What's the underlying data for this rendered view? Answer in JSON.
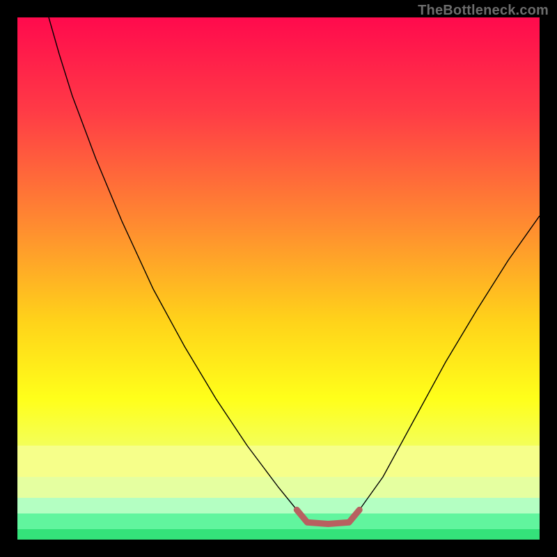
{
  "watermark": "TheBottleneck.com",
  "chart_data": {
    "type": "line",
    "title": "",
    "xlabel": "",
    "ylabel": "",
    "xlim": [
      0,
      100
    ],
    "ylim": [
      0,
      100
    ],
    "grid": false,
    "background_gradient": {
      "stops": [
        {
          "t": 0.0,
          "color": "#ff0a4d"
        },
        {
          "t": 0.18,
          "color": "#ff3b46"
        },
        {
          "t": 0.4,
          "color": "#ff8c30"
        },
        {
          "t": 0.58,
          "color": "#ffd21a"
        },
        {
          "t": 0.73,
          "color": "#ffff1a"
        },
        {
          "t": 0.84,
          "color": "#f1ff66"
        },
        {
          "t": 0.94,
          "color": "#9dffb8"
        },
        {
          "t": 1.0,
          "color": "#34e27a"
        }
      ],
      "bottom_stripes": [
        {
          "y_from": 82,
          "y_to": 88,
          "color": "#f6ff8a"
        },
        {
          "y_from": 88,
          "y_to": 92,
          "color": "#e5ffa0"
        },
        {
          "y_from": 92,
          "y_to": 95,
          "color": "#b4ffc2"
        },
        {
          "y_from": 95,
          "y_to": 98,
          "color": "#61f59e"
        },
        {
          "y_from": 98,
          "y_to": 100,
          "color": "#34e27a"
        }
      ]
    },
    "series": [
      {
        "name": "curve-left",
        "color": "#000000",
        "width": 1.4,
        "points": [
          {
            "x": 6.0,
            "y": 0.0
          },
          {
            "x": 8.0,
            "y": 7.0
          },
          {
            "x": 10.5,
            "y": 15.0
          },
          {
            "x": 15.0,
            "y": 27.0
          },
          {
            "x": 20.0,
            "y": 39.0
          },
          {
            "x": 26.0,
            "y": 52.0
          },
          {
            "x": 32.0,
            "y": 63.0
          },
          {
            "x": 38.0,
            "y": 73.0
          },
          {
            "x": 44.0,
            "y": 82.0
          },
          {
            "x": 50.0,
            "y": 90.0
          },
          {
            "x": 53.5,
            "y": 94.3
          }
        ]
      },
      {
        "name": "curve-right",
        "color": "#000000",
        "width": 1.4,
        "points": [
          {
            "x": 65.5,
            "y": 94.3
          },
          {
            "x": 70.0,
            "y": 88.0
          },
          {
            "x": 76.0,
            "y": 77.0
          },
          {
            "x": 82.0,
            "y": 66.0
          },
          {
            "x": 88.0,
            "y": 56.0
          },
          {
            "x": 94.0,
            "y": 46.5
          },
          {
            "x": 100.0,
            "y": 38.0
          }
        ]
      },
      {
        "name": "valley-floor",
        "color": "#b86060",
        "width": 9.0,
        "linecap": "round",
        "points": [
          {
            "x": 53.5,
            "y": 94.3
          },
          {
            "x": 55.5,
            "y": 96.7
          },
          {
            "x": 59.5,
            "y": 97.0
          },
          {
            "x": 63.5,
            "y": 96.7
          },
          {
            "x": 65.5,
            "y": 94.3
          }
        ]
      }
    ]
  }
}
